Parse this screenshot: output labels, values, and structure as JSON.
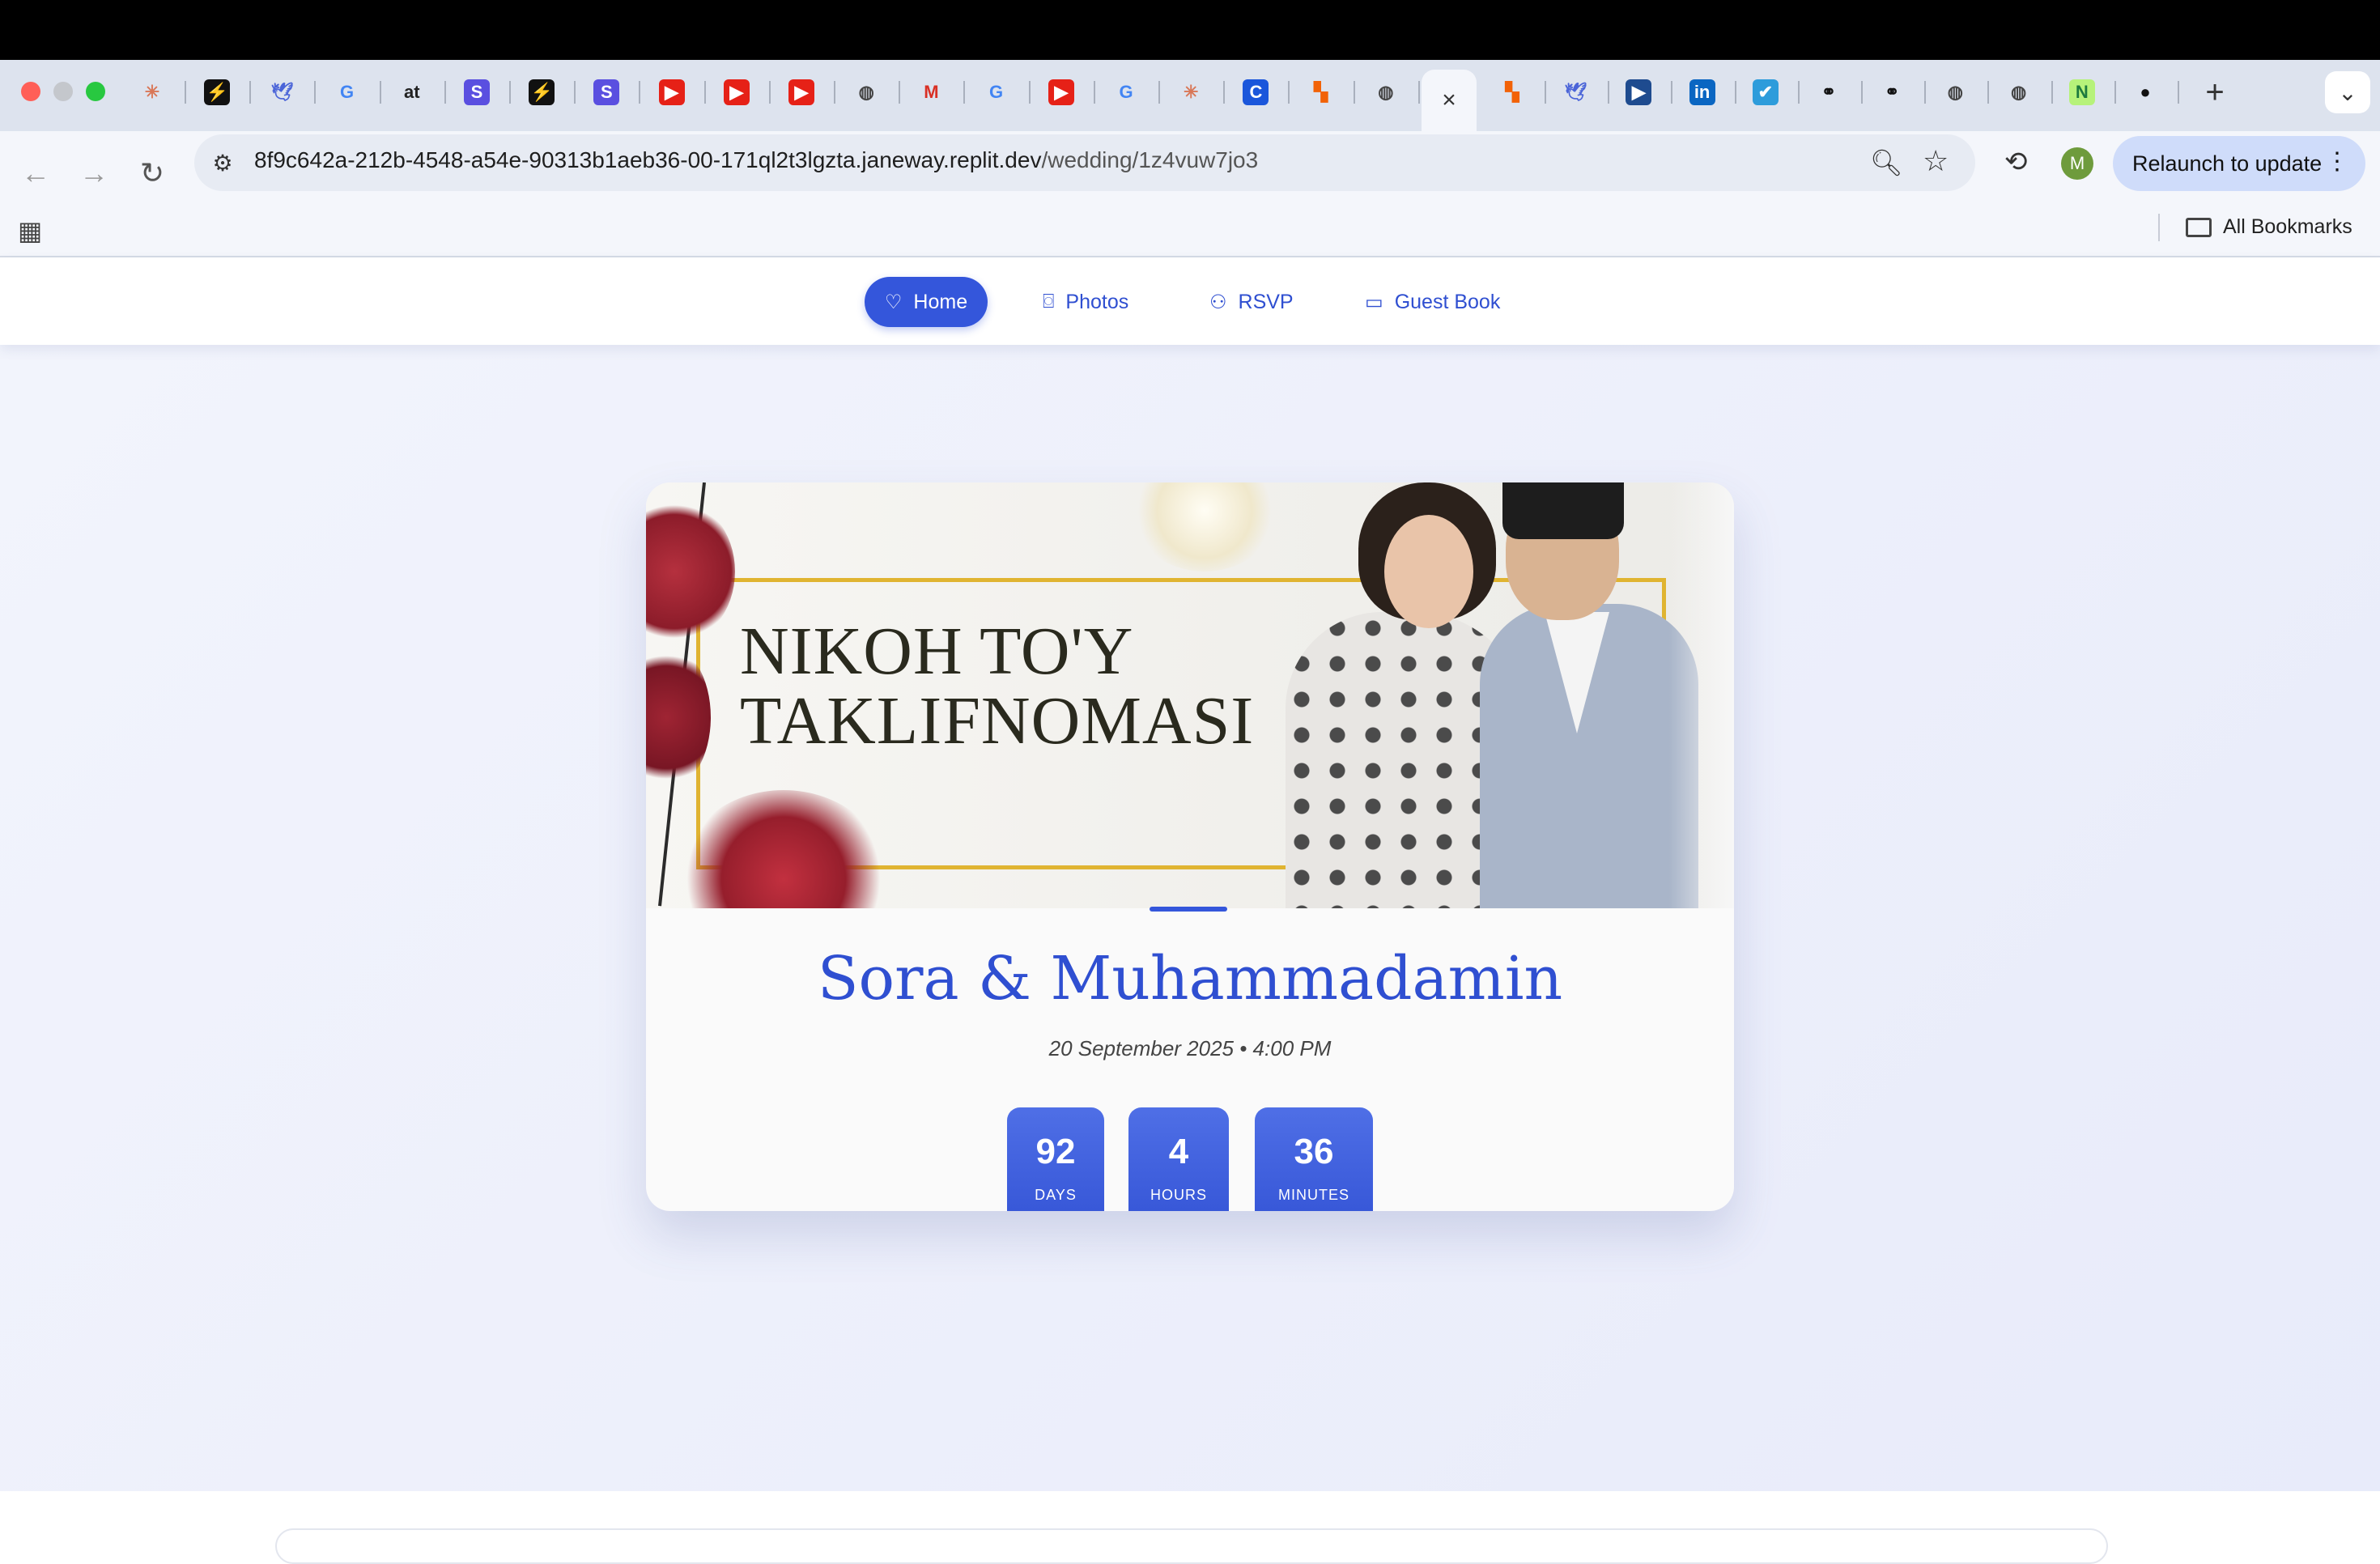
{
  "browser": {
    "address": {
      "host": "8f9c642a-212b-4548-a54e-90313b1aeb36-00-171ql2t3lgzta.janeway.replit.dev",
      "path": "/wedding/1z4vuw7jo3"
    },
    "relaunch_label": "Relaunch to update",
    "profile_initial": "M",
    "all_bookmarks_label": "All Bookmarks",
    "active_tab_close": "×",
    "new_tab": "+"
  },
  "tabs": [
    {
      "icon": "claude-icon",
      "glyph": "✳",
      "bg": "transparent",
      "color": "#d97757"
    },
    {
      "icon": "bolt-icon",
      "glyph": "⚡",
      "bg": "#111111",
      "color": "#3ddc84"
    },
    {
      "icon": "bird-icon",
      "glyph": "🕊",
      "bg": "transparent",
      "color": "#4a64d8"
    },
    {
      "icon": "google-icon",
      "glyph": "G",
      "bg": "transparent",
      "color": "#4285f4"
    },
    {
      "icon": "at-icon",
      "glyph": "at",
      "bg": "transparent",
      "color": "#222222"
    },
    {
      "icon": "s-icon",
      "glyph": "S",
      "bg": "#5a4fe0",
      "color": "#ffffff"
    },
    {
      "icon": "bolt-icon",
      "glyph": "⚡",
      "bg": "#111111",
      "color": "#3ddc84"
    },
    {
      "icon": "s-icon",
      "glyph": "S",
      "bg": "#5a4fe0",
      "color": "#ffffff"
    },
    {
      "icon": "youtube-icon",
      "glyph": "▶",
      "bg": "#e62117",
      "color": "#ffffff"
    },
    {
      "icon": "youtube-icon",
      "glyph": "▶",
      "bg": "#e62117",
      "color": "#ffffff"
    },
    {
      "icon": "youtube-icon",
      "glyph": "▶",
      "bg": "#e62117",
      "color": "#ffffff"
    },
    {
      "icon": "globe-icon",
      "glyph": "◍",
      "bg": "transparent",
      "color": "#444444"
    },
    {
      "icon": "gmail-icon",
      "glyph": "M",
      "bg": "transparent",
      "color": "#d93025"
    },
    {
      "icon": "google-icon",
      "glyph": "G",
      "bg": "transparent",
      "color": "#4285f4"
    },
    {
      "icon": "youtube-icon",
      "glyph": "▶",
      "bg": "#e62117",
      "color": "#ffffff"
    },
    {
      "icon": "google-icon",
      "glyph": "G",
      "bg": "transparent",
      "color": "#4285f4"
    },
    {
      "icon": "claude-icon",
      "glyph": "✳",
      "bg": "transparent",
      "color": "#d97757"
    },
    {
      "icon": "c-icon",
      "glyph": "C",
      "bg": "#1a56db",
      "color": "#ffffff"
    },
    {
      "icon": "replit-icon",
      "glyph": "▚",
      "bg": "transparent",
      "color": "#f26207"
    },
    {
      "icon": "globe-icon",
      "glyph": "◍",
      "bg": "transparent",
      "color": "#444444"
    }
  ],
  "tabs_right": [
    {
      "icon": "replit-icon",
      "glyph": "▚",
      "bg": "transparent",
      "color": "#f26207"
    },
    {
      "icon": "bird-icon",
      "glyph": "🕊",
      "bg": "transparent",
      "color": "#4a64d8"
    },
    {
      "icon": "video-icon",
      "glyph": "▶",
      "bg": "#1e4b8f",
      "color": "#ffffff"
    },
    {
      "icon": "linkedin-icon",
      "glyph": "in",
      "bg": "#0a66c2",
      "color": "#ffffff"
    },
    {
      "icon": "check-icon",
      "glyph": "✔",
      "bg": "#2d9cdb",
      "color": "#ffffff"
    },
    {
      "icon": "link-icon",
      "glyph": "⚭",
      "bg": "transparent",
      "color": "#111111"
    },
    {
      "icon": "link-check-icon",
      "glyph": "⚭",
      "bg": "transparent",
      "color": "#111111"
    },
    {
      "icon": "globe-icon",
      "glyph": "◍",
      "bg": "transparent",
      "color": "#444444"
    },
    {
      "icon": "globe-icon",
      "glyph": "◍",
      "bg": "transparent",
      "color": "#444444"
    },
    {
      "icon": "n-icon",
      "glyph": "N",
      "bg": "#b6f27a",
      "color": "#1c7a3e"
    },
    {
      "icon": "github-icon",
      "glyph": "●",
      "bg": "transparent",
      "color": "#111111"
    }
  ],
  "nav": {
    "home": "Home",
    "photos": "Photos",
    "rsvp": "RSVP",
    "guest_book": "Guest Book"
  },
  "hero": {
    "banner_title": "NIKOH TO'Y TAKLIFNOMASI",
    "couple_names": "Sora & Muhammadamin",
    "date_line": "20 September 2025 • 4:00 PM"
  },
  "countdown": {
    "days": {
      "value": "92",
      "label": "DAYS"
    },
    "hours": {
      "value": "4",
      "label": "HOURS"
    },
    "minutes": {
      "value": "36",
      "label": "MINUTES"
    }
  },
  "colors": {
    "accent": "#3456db",
    "gold": "#e0b431"
  }
}
